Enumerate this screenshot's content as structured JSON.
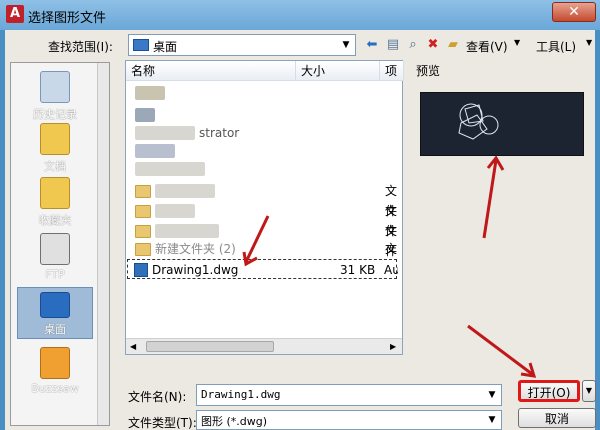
{
  "window": {
    "title": "选择图形文件",
    "close_label": "✕"
  },
  "toolbar": {
    "lookin_label": "查找范围(I):",
    "lookin_value": "桌面",
    "views_label": "查看(V)",
    "tools_label": "工具(L)"
  },
  "places": [
    {
      "label": "历史记录"
    },
    {
      "label": "文档"
    },
    {
      "label": "收藏夹"
    },
    {
      "label": "FTP"
    },
    {
      "label": "桌面"
    },
    {
      "label": "Buzzsaw"
    }
  ],
  "file_list": {
    "columns": [
      "名称",
      "大小",
      "项目"
    ],
    "rows": [
      {
        "name": "",
        "size": "",
        "type": ""
      },
      {
        "name": "",
        "size": "",
        "type": ""
      },
      {
        "name": "strator",
        "size": "",
        "type": ""
      },
      {
        "name": "",
        "size": "",
        "type": ""
      },
      {
        "name": "",
        "size": "",
        "type": ""
      },
      {
        "name": "",
        "size": "",
        "type": "文件"
      },
      {
        "name": "",
        "size": "",
        "type": "文件"
      },
      {
        "name": "",
        "size": "",
        "type": "文件"
      },
      {
        "name": "新建文件夹 (2)",
        "size": "",
        "type": "文件"
      },
      {
        "name": "Drawing1.dwg",
        "size": "31 KB",
        "type": "Auto"
      }
    ]
  },
  "preview": {
    "label": "预览"
  },
  "bottom": {
    "filename_label": "文件名(N):",
    "filename_value": "Drawing1.dwg",
    "filetype_label": "文件类型(T):",
    "filetype_value": "图形 (*.dwg)",
    "open_label": "打开(O)",
    "cancel_label": "取消"
  },
  "colors": {
    "accent_red": "#c01818",
    "preview_bg": "#1b2430"
  }
}
